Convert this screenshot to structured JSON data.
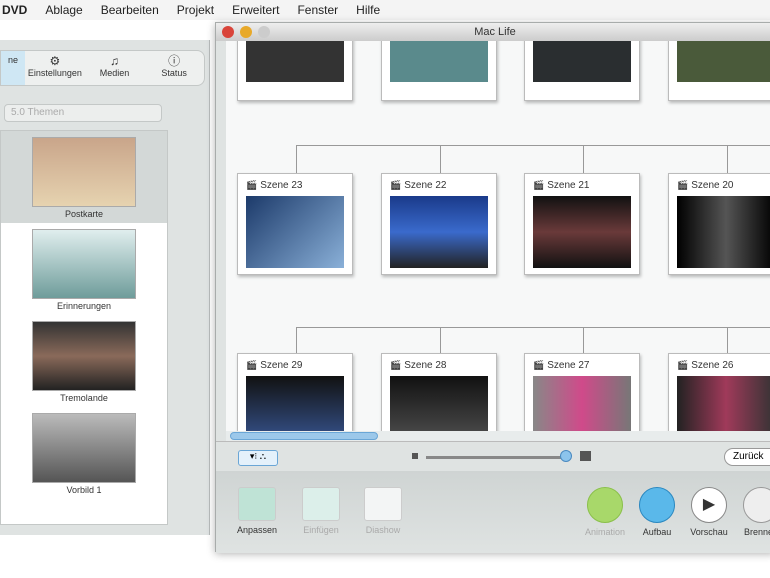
{
  "menubar": {
    "items": [
      "DVD",
      "Ablage",
      "Bearbeiten",
      "Projekt",
      "Erweitert",
      "Fenster",
      "Hilfe"
    ]
  },
  "sidebar": {
    "tabs": [
      {
        "label": "ne",
        "icon": ""
      },
      {
        "label": "Einstellungen",
        "icon": "gear-icon"
      },
      {
        "label": "Medien",
        "icon": "media-icon"
      },
      {
        "label": "Status",
        "icon": "info-icon"
      }
    ],
    "theme_select": "5.0 Themen",
    "themes": [
      "Postkarte",
      "Erinnerungen",
      "Tremolande",
      "Vorbild 1"
    ]
  },
  "window": {
    "title": "Mac Life",
    "row2": [
      "Szene 23",
      "Szene 22",
      "Szene 21",
      "Szene 20"
    ],
    "row3": [
      "Szene 29",
      "Szene 28",
      "Szene 27",
      "Szene 26"
    ],
    "back_button": "Zurück",
    "toolbar": [
      "Anpassen",
      "Einfügen",
      "Diashow",
      "Animation",
      "Aufbau",
      "Vorschau",
      "Brennen"
    ]
  }
}
